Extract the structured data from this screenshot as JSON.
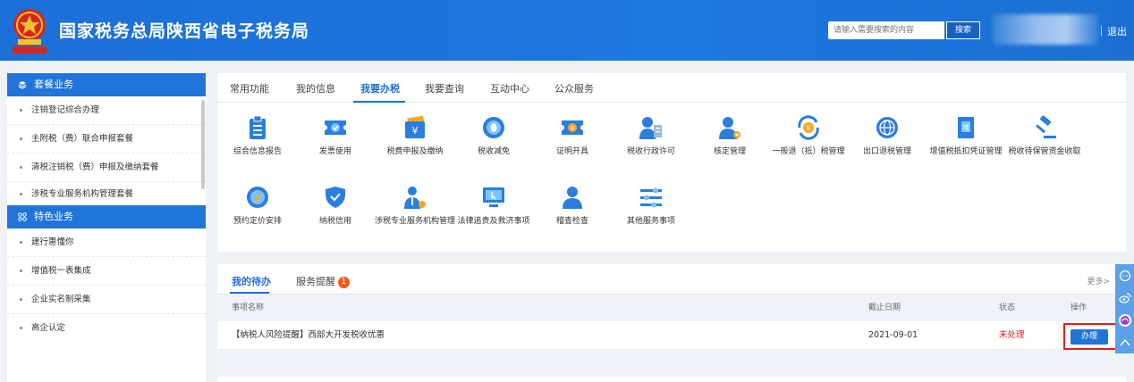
{
  "header": {
    "title": "国家税务总局陕西省电子税务局",
    "search_placeholder": "请输入需要搜索的内容",
    "search_label": "搜索",
    "logout_label": "退出"
  },
  "sidebar": {
    "sections": [
      {
        "title": "套餐业务",
        "items": [
          "注销登记综合办理",
          "主附税（费）联合申报套餐",
          "清税注销税（费）申报及缴纳套餐",
          "涉税专业服务机构管理套餐"
        ]
      },
      {
        "title": "特色业务",
        "items": [
          "建行惠懂你",
          "增值税一表集成",
          "企业实名制采集",
          "高企认定"
        ]
      }
    ]
  },
  "main": {
    "tabs": [
      "常用功能",
      "我的信息",
      "我要办税",
      "我要查询",
      "互动中心",
      "公众服务"
    ],
    "active_tab": "我要办税",
    "functions": [
      {
        "label": "综合信息报告",
        "icon": "clipboard-icon"
      },
      {
        "label": "发票使用",
        "icon": "ticket-icon"
      },
      {
        "label": "税费申报及缴纳",
        "icon": "wallet-yuan-icon"
      },
      {
        "label": "税收减免",
        "icon": "coin-icon"
      },
      {
        "label": "证明开具",
        "icon": "certificate-icon"
      },
      {
        "label": "税收行政许可",
        "icon": "user-document-icon"
      },
      {
        "label": "核定管理",
        "icon": "user-gear-icon"
      },
      {
        "label": "一般退（抵）税管理",
        "icon": "refund-icon"
      },
      {
        "label": "出口退税管理",
        "icon": "globe-icon"
      },
      {
        "label": "增值税抵扣凭证管理",
        "icon": "vat-voucher-icon"
      },
      {
        "label": "税收待保管资金收取",
        "icon": "gavel-icon"
      },
      {
        "label": "预约定价安排",
        "icon": "pen-circle-icon"
      },
      {
        "label": "纳税信用",
        "icon": "shield-check-icon"
      },
      {
        "label": "涉税专业服务机构管理",
        "icon": "agency-icon"
      },
      {
        "label": "法律追责及救济事项",
        "icon": "monitor-icon"
      },
      {
        "label": "稽查检查",
        "icon": "inspector-icon"
      },
      {
        "label": "其他服务事项",
        "icon": "sliders-icon"
      }
    ]
  },
  "todo": {
    "tabs": [
      "我的待办",
      "服务提醒"
    ],
    "reminder_count": "1",
    "more_label": "更多>",
    "columns": [
      "事项名称",
      "截止日期",
      "状态",
      "操作"
    ],
    "rows": [
      {
        "name": "【纳税人风险提醒】西部大开发税收优惠",
        "deadline": "2021-09-01",
        "status": "未处理",
        "action": "办理"
      }
    ]
  },
  "colors": {
    "primary": "#1f75d9",
    "header": "#1c6fd6",
    "alert": "#e02020",
    "badge": "#f05a1a"
  }
}
